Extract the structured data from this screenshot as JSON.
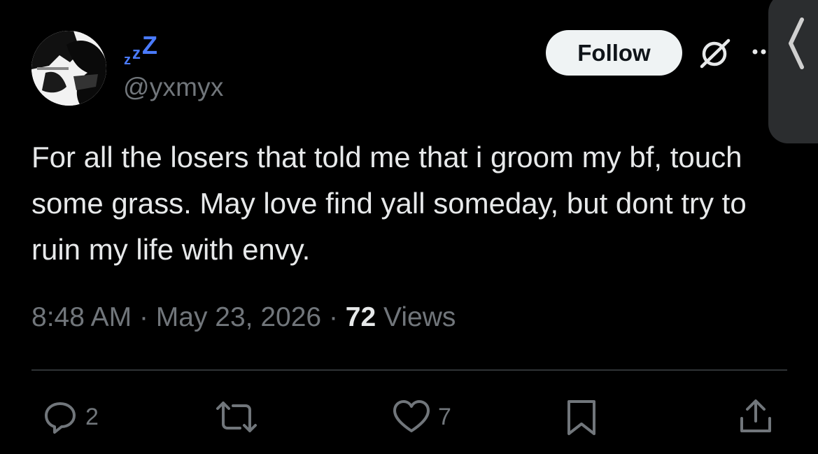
{
  "author": {
    "display_name": "zzZ",
    "handle": "@yxmyx"
  },
  "follow_button": {
    "label": "Follow"
  },
  "tweet": {
    "text": "For all the losers that told me that i groom my bf, touch some grass. May love find yall someday, but dont try to ruin my life with envy.",
    "time": "8:48 AM",
    "separator": "·",
    "date": "May 23, 2026",
    "views_count": "72",
    "views_label": "Views"
  },
  "actions": {
    "reply_count": "2",
    "like_count": "7"
  },
  "icons": {
    "reply": "reply-icon",
    "repost": "repost-icon",
    "like": "heart-icon",
    "bookmark": "bookmark-icon",
    "share": "share-icon",
    "grok": "grok-icon",
    "more": "more-icon",
    "side_tab": "chevron-left-icon"
  },
  "colors": {
    "background": "#000000",
    "primary_text": "#e7e9ea",
    "secondary_text": "#71767b",
    "follow_bg": "#eff3f4",
    "divider": "#2f3336",
    "display_name_accent": "#4a7bff"
  }
}
